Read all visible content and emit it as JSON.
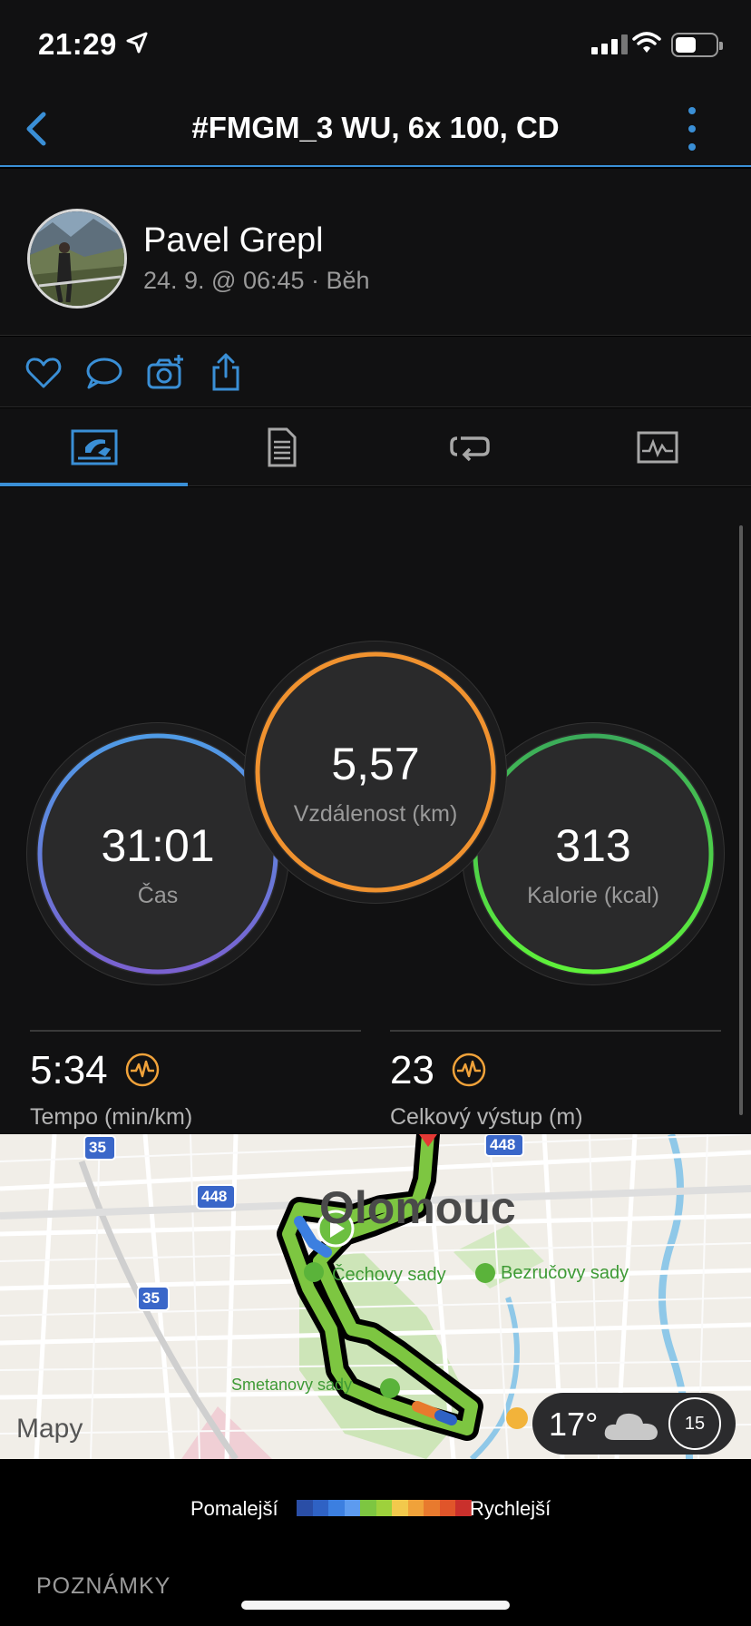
{
  "status_bar": {
    "time": "21:29"
  },
  "nav": {
    "title": "#FMGM_3 WU, 6x 100, CD"
  },
  "profile": {
    "name": "Pavel Grepl",
    "subtitle": "24. 9. @ 06:45 · Běh"
  },
  "actions": [
    "heart-icon",
    "comment-icon",
    "camera-icon",
    "share-icon"
  ],
  "tabs": [
    {
      "icon": "stats-tab-icon",
      "active": true
    },
    {
      "icon": "details-tab-icon",
      "active": false
    },
    {
      "icon": "laps-tab-icon",
      "active": false
    },
    {
      "icon": "charts-tab-icon",
      "active": false
    }
  ],
  "stats": {
    "time": {
      "value": "31:01",
      "label": "Čas",
      "color": "#5b8fdc"
    },
    "distance": {
      "value": "5,57",
      "label": "Vzdálenost (km)",
      "color": "#f0922f"
    },
    "calories": {
      "value": "313",
      "label": "Kalorie (kcal)",
      "color": "#4cd34a"
    },
    "pace": {
      "value": "5:34",
      "label": "Tempo (min/km)"
    },
    "ascent": {
      "value": "23",
      "label": "Celkový výstup (m)"
    }
  },
  "map": {
    "city": "Olomouc",
    "places": [
      "Čechovy sady",
      "Bezručovy sady",
      "Smetanovy sady"
    ],
    "road_badges": [
      "35",
      "448",
      "35",
      "448"
    ],
    "attribution": "Mapy",
    "weather": {
      "temp": "17°",
      "aqi": "15"
    }
  },
  "legend": {
    "slow": "Pomalejší",
    "fast": "Rychlejší",
    "colors": [
      "#2a4ea6",
      "#2f62c4",
      "#3c7fe0",
      "#5d9bef",
      "#7dc641",
      "#9ed13c",
      "#f2c94c",
      "#f0a23a",
      "#e87a2e",
      "#e0552a",
      "#c9302c"
    ]
  },
  "notes": {
    "title": "POZNÁMKY"
  }
}
